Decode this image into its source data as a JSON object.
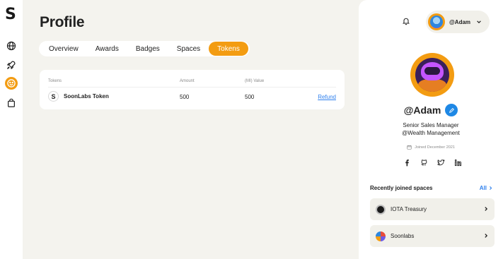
{
  "app": {
    "logo_letter": "S"
  },
  "sidebar": {
    "icons": [
      {
        "name": "globe-icon"
      },
      {
        "name": "rocket-icon"
      },
      {
        "name": "smiley-icon",
        "active": true
      },
      {
        "name": "shopping-bag-icon"
      }
    ]
  },
  "page": {
    "title": "Profile",
    "tabs": [
      {
        "label": "Overview"
      },
      {
        "label": "Awards"
      },
      {
        "label": "Badges"
      },
      {
        "label": "Spaces"
      },
      {
        "label": "Tokens",
        "active": true
      }
    ]
  },
  "tokens_table": {
    "columns": {
      "token": "Tokens",
      "amount": "Amount",
      "value": "(MI) Value"
    },
    "rows": [
      {
        "icon_letter": "S",
        "name": "SoonLabs Token",
        "amount": "500",
        "value": "500",
        "action": "Refund"
      }
    ]
  },
  "header": {
    "username": "@Adam"
  },
  "profile": {
    "name": "@Adam",
    "role_line1": "Senior Sales Manager",
    "role_line2": "@Wealth Management",
    "joined": "Joined December 2021",
    "socials": [
      "facebook-icon",
      "github-icon",
      "twitter-icon",
      "linkedin-icon"
    ]
  },
  "recent_spaces": {
    "title": "Recently joined spaces",
    "all_label": "All",
    "items": [
      {
        "name": "IOTA Treasury"
      },
      {
        "name": "Soonlabs"
      }
    ]
  },
  "colors": {
    "accent": "#f39c12",
    "link": "#2f80ed",
    "edit_button": "#1e88e5",
    "background": "#f4f3ee"
  }
}
